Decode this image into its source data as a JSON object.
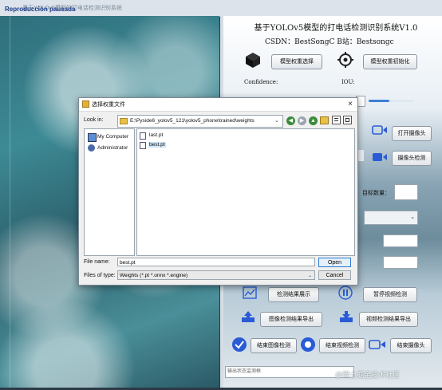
{
  "window": {
    "title": "基于YOLOv5模型的打电话检测识别系统",
    "overlay_label": "Reproducción pausada"
  },
  "panel": {
    "title": "基于YOLOv5模型的打电话检测识别系统V1.0",
    "csdn": "CSDN：BestSongC  B站：Bestsongc",
    "model_select": "模型权重选择",
    "model_init": "模型权重初始化",
    "confidence_label": "Confidence:",
    "iou_label": "IOU:",
    "open_camera": "打开摄像头",
    "camera_detect": "摄像头检测",
    "target_count_label": "目标数量：",
    "show_result": "检测结果展示",
    "pause_video": "暂停视频检测",
    "export_image": "图像检测结果导出",
    "export_video": "视频检测结果导出",
    "end_image": "结束图像检测",
    "end_video": "结束视频检测",
    "end_camera": "结束摄像头",
    "status": "输出状态监测框"
  },
  "watermark": "@稀土掘金技术社区",
  "dialog": {
    "title": "选择权重文件",
    "look_in_label": "Look in:",
    "look_in_path": "E:\\Pyside6_yolov5_121\\yolov5_phone\\trained\\weights",
    "places": [
      "My Computer",
      "Administrator"
    ],
    "files": [
      "last.pt",
      "best.pt"
    ],
    "file_name_label": "File name:",
    "file_name_value": "best.pt",
    "file_type_label": "Files of type:",
    "file_type_value": "Weights (*.pt *.onnx *.engine)",
    "open_label": "Open",
    "cancel_label": "Cancel"
  }
}
